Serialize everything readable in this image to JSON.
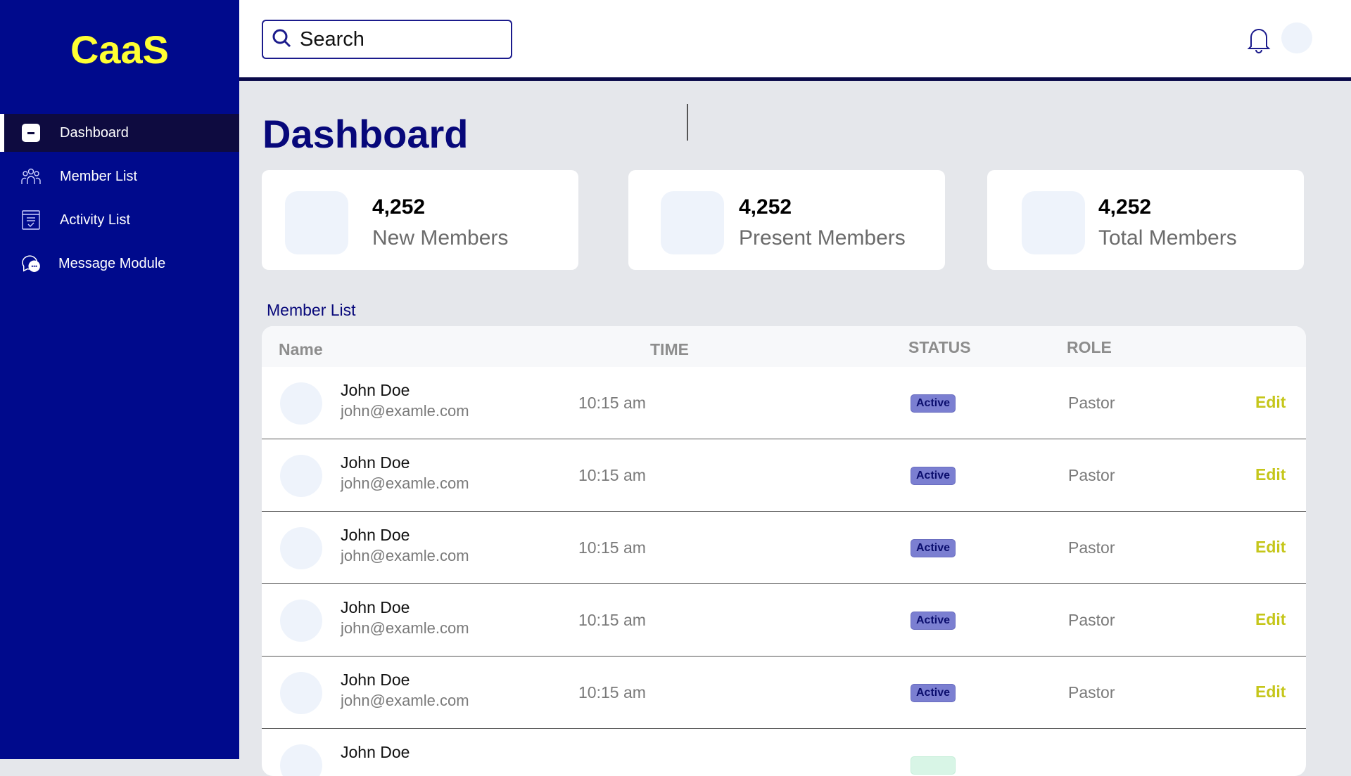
{
  "app": {
    "logo": "CaaS"
  },
  "sidebar": {
    "items": [
      {
        "label": "Dashboard",
        "icon": "dashboard-icon",
        "active": true
      },
      {
        "label": "Member List",
        "icon": "users-icon"
      },
      {
        "label": "Activity List",
        "icon": "checklist-icon"
      },
      {
        "label": "Message Module",
        "icon": "chat-icon"
      }
    ]
  },
  "header": {
    "search_placeholder": "Search",
    "icons": [
      "search-icon",
      "bell-icon",
      "user-avatar"
    ]
  },
  "main": {
    "title": "Dashboard",
    "stats": [
      {
        "value": "4,252",
        "label": "New Members"
      },
      {
        "value": "4,252",
        "label": "Present Members"
      },
      {
        "value": "4,252",
        "label": "Total Members"
      }
    ],
    "member_list_label": "Member List",
    "table": {
      "columns": [
        "Name",
        "TIME",
        "STATUS",
        "ROLE"
      ],
      "rows": [
        {
          "name": "John Doe",
          "email": "john@examle.com",
          "time": "10:15 am",
          "status": "Active",
          "role": "Pastor",
          "action": "Edit"
        },
        {
          "name": "John Doe",
          "email": "john@examle.com",
          "time": "10:15 am",
          "status": "Active",
          "role": "Pastor",
          "action": "Edit"
        },
        {
          "name": "John Doe",
          "email": "john@examle.com",
          "time": "10:15 am",
          "status": "Active",
          "role": "Pastor",
          "action": "Edit"
        },
        {
          "name": "John Doe",
          "email": "john@examle.com",
          "time": "10:15 am",
          "status": "Active",
          "role": "Pastor",
          "action": "Edit"
        },
        {
          "name": "John Doe",
          "email": "john@examle.com",
          "time": "10:15 am",
          "status": "Active",
          "role": "Pastor",
          "action": "Edit"
        },
        {
          "name": "John Doe"
        }
      ]
    }
  },
  "colors": {
    "sidebar_bg": "#000a8c",
    "logo": "#ffff33",
    "title": "#07087a",
    "edit": "#c5c61a",
    "status_badge": "#7b7fd1"
  }
}
